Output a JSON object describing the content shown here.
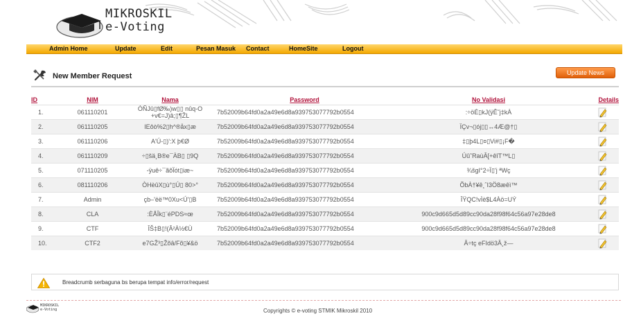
{
  "brand": {
    "line1": "MIKROSKIL",
    "line2": "e-Voting"
  },
  "nav": [
    {
      "label": "Admin Home"
    },
    {
      "label": "Update"
    },
    {
      "label": "Edit"
    },
    {
      "label": "Pesan Masuk"
    },
    {
      "label": "Contact"
    },
    {
      "label": "HomeSite"
    },
    {
      "label": "Logout"
    }
  ],
  "page": {
    "title": "New Member Request",
    "update_news_label": "Update News"
  },
  "table": {
    "headers": {
      "id": "ID",
      "nim": "NIM",
      "nama": "Nama",
      "password": "Password",
      "no_validasi": "No Validasi",
      "details": "Details"
    },
    "rows": [
      {
        "id": "1.",
        "nim": "061110201",
        "nama": "ÓÑJû▯fØ‰)w▯▯ nûq-O +v€=J)â;▯¶ŽL",
        "password": "7b52009b64fd0a2a49e6d8a939753077792b0554",
        "no_validasi": ":÷öÉ▯kJ(ÿÊ˜j‡kÀ"
      },
      {
        "id": "2.",
        "nim": "061110205",
        "nama": "IEôò%2▯h^®åx▯æ",
        "password": "7b52009b64fd0a2a49e6d8a939753077792b0554",
        "no_validasi": "ÏÇv¬▯ój▯▯↔4Æ@†▯"
      },
      {
        "id": "3.",
        "nim": "061110206",
        "nama": "A'Ú-▯)':X þ€Ø",
        "password": "7b52009b64fd0a2a49e6d8a939753077792b0554",
        "no_validasi": "‡▯þ4L▯¤▯Vi#▯¡F�"
      },
      {
        "id": "4.",
        "nim": "061110209",
        "nama": "÷▯šä¸B®e¯ÀB▯ ▯9Q",
        "password": "7b52009b64fd0a2a49e6d8a939753077792b0554",
        "no_validasi": "Úû˜RaùÂ[+êîT™L▯"
      },
      {
        "id": "5.",
        "nim": "071110205",
        "nama": "-ÿuê÷¯ãõÏót▯iæ~",
        "password": "7b52009b64fd0a2a49e6d8a939753077792b0554",
        "no_validasi": "¾šgI°2÷Ï▯'j ªWç"
      },
      {
        "id": "6.",
        "nim": "081110206",
        "nama": "ÒHèûX▯ù°▯Ú▯ 80>°",
        "password": "7b52009b64fd0a2a49e6d8a939753077792b0554",
        "no_validasi": "ÕbÀ†¥ê¸ˆI3Ö8æêì™"
      },
      {
        "id": "7.",
        "nim": "Admin",
        "nama": "çb–'ëë™0Xu<Ú'▯B",
        "password": "7b52009b64fd0a2a49e6d8a939753077792b0554",
        "no_validasi": "ÎŸQC!vÌè$L4Àö=UÝ"
      },
      {
        "id": "8.",
        "nim": "CLA",
        "nama": ":ÈÅÎk▯¨éPDS≈œ",
        "password": "7b52009b64fd0a2a49e6d8a939753077792b0554",
        "no_validasi": "900c9d665d5d89cc90da28f98f64c56a97e28de8"
      },
      {
        "id": "9.",
        "nim": "CTF",
        "nama": "ÎŠ‡B▯!(Â²À½€Ù",
        "password": "7b52009b64fd0a2a49e6d8a939753077792b0554",
        "no_validasi": "900c9d665d5d89cc90da28f98f64c56a97e28de8"
      },
      {
        "id": "10.",
        "nim": "CTF2",
        "nama": "e7GŽ³▯Žõâ/Fõ▯¥&ö",
        "password": "7b52009b64fd0a2a49e6d8a939753077792b0554",
        "no_validasi": "Â÷tç eFIdö3Â¸ž—"
      }
    ]
  },
  "breadcrumb": {
    "text": "Breadcrumb serbaguna bs berupa tempat info/error/request"
  },
  "footer": {
    "logo_line1": "MIKROSKIL",
    "logo_line2": "e-Voting",
    "copyright": "Copyrights © e-voting STMIK Mikroskil 2010"
  },
  "icons": {
    "logo": "graduation-cap-icon",
    "tools": "tools-icon",
    "edit": "pencil-edit-icon",
    "warning": "warning-icon"
  },
  "colors": {
    "nav_bar": "#f4a800",
    "header_link": "#b0113a",
    "update_button": "#e0600a"
  }
}
